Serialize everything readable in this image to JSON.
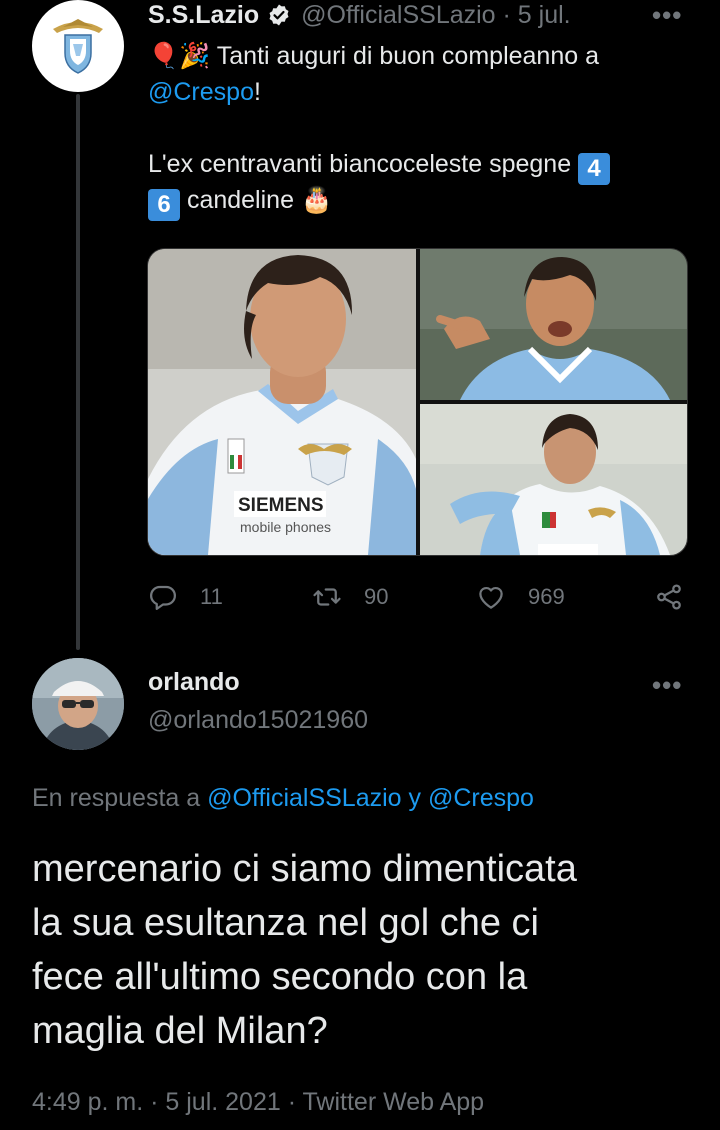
{
  "tweet1": {
    "author_name": "S.S.Lazio",
    "handle_time": "@OfficialSSLazio · 5 jul.",
    "text_line1_rest": " Tanti auguri di buon compleanno a",
    "mention": "@Crespo",
    "text_line2_rest": "!",
    "text_line3": "L'ex centravanti biancoceleste spegne ",
    "key4": "4",
    "key6": "6",
    "text_line4_rest": " candeline ",
    "emoji_balloon": "🎈",
    "emoji_party": "🎉",
    "emoji_cake": "🎂",
    "actions": {
      "replies": "11",
      "retweets": "90",
      "likes": "969"
    },
    "media_colors": {
      "sky": "#8fb6d8",
      "kit_light": "#e9eef3",
      "kit_blue": "#7fb0de",
      "pitch": "#2f5a2a"
    }
  },
  "tweet2": {
    "author_name": "orlando",
    "handle": "@orlando15021960",
    "reply_prefix": "En respuesta a ",
    "reply_user1": "@OfficialSSLazio",
    "reply_connector": " y ",
    "reply_user2": "@Crespo",
    "body_lines": [
      "mercenario ci siamo dimenticata",
      "la sua esultanza nel gol che ci",
      "fece all'ultimo secondo con la",
      "maglia del Milan?"
    ],
    "meta": "4:49 p. m. · 5 jul. 2021 · Twitter Web App"
  },
  "colors": {
    "background": "#000000",
    "text": "#e7e9ea",
    "muted": "#71767b",
    "link": "#1d9bf0",
    "keycap": "#3a8ddb"
  }
}
